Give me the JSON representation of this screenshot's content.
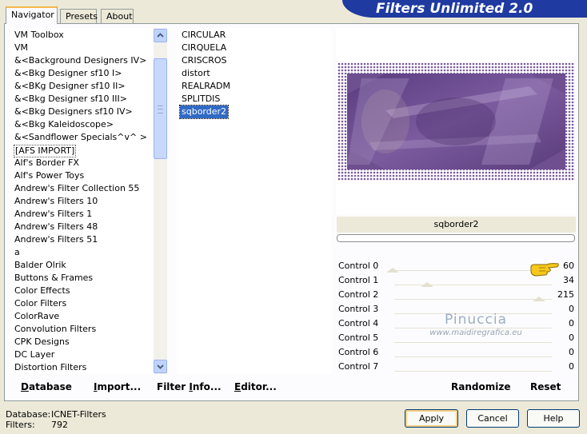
{
  "window": {
    "title": "Filters Unlimited 2.0"
  },
  "tabs": [
    {
      "label": "Navigator",
      "active": true
    },
    {
      "label": "Presets",
      "active": false
    },
    {
      "label": "About",
      "active": false
    }
  ],
  "categories": {
    "selected": "[AFS IMPORT]",
    "items": [
      "VM Toolbox",
      "VM",
      "&<Background Designers IV>",
      "&<Bkg Designer sf10 I>",
      "&<BKg Designer sf10 II>",
      "&<Bkg Designer sf10 III>",
      "&<Bkg Designers sf10 IV>",
      "&<Bkg Kaleidoscope>",
      "&<Sandflower Specials^v^ >",
      "[AFS IMPORT]",
      "Alf's Border FX",
      "Alf's Power Toys",
      "Andrew's Filter Collection 55",
      "Andrew's Filters 10",
      "Andrew's Filters 1",
      "Andrew's Filters 48",
      "Andrew's Filters 51",
      "a",
      "Balder Olrik",
      "Buttons & Frames",
      "Color Effects",
      "Color Filters",
      "ColorRave",
      "Convolution Filters",
      "CPK Designs",
      "DC Layer",
      "Distortion Filters"
    ]
  },
  "filters": {
    "selected": "sqborder2",
    "items": [
      "CIRCULAR",
      "CIRQUELA",
      "CRISCROS",
      "distort",
      "REALRADM",
      "SPLITDIS",
      "sqborder2"
    ]
  },
  "preview": {
    "filter_name": "sqborder2"
  },
  "controls": [
    {
      "label": "Control 0",
      "value": "60"
    },
    {
      "label": "Control 1",
      "value": "34"
    },
    {
      "label": "Control 2",
      "value": "215"
    },
    {
      "label": "Control 3",
      "value": "0"
    },
    {
      "label": "Control 4",
      "value": "0"
    },
    {
      "label": "Control 5",
      "value": "0"
    },
    {
      "label": "Control 6",
      "value": "0"
    },
    {
      "label": "Control 7",
      "value": "0"
    }
  ],
  "watermark": {
    "line1": "Pinuccia",
    "line2": "www.maidiregrafica.eu"
  },
  "actions": {
    "database": {
      "pre": "",
      "u": "D",
      "post": "atabase"
    },
    "import": {
      "pre": "",
      "u": "I",
      "post": "mport..."
    },
    "filter_info": {
      "pre": "Filter ",
      "u": "I",
      "post": "nfo..."
    },
    "editor": {
      "pre": "",
      "u": "E",
      "post": "ditor..."
    },
    "randomize": "Randomize",
    "reset": "Reset"
  },
  "status": {
    "database_label": "Database:",
    "database_value": "ICNET-Filters",
    "filters_label": "Filters:",
    "filters_value": "792"
  },
  "buttons": {
    "apply": "Apply",
    "cancel": "Cancel",
    "help": "Help"
  },
  "colors": {
    "title_bar": "#1f3aa0",
    "selection": "#316ac5",
    "preview_purple": "#6b4a8a"
  }
}
